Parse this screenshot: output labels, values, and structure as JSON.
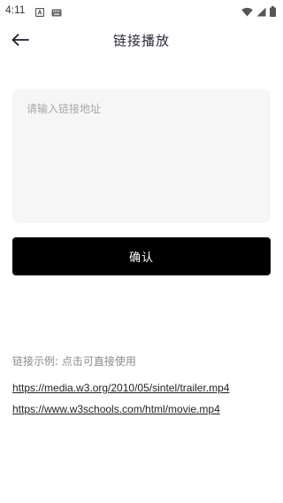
{
  "status_bar": {
    "time": "4:11",
    "icons": [
      "notification-a-icon",
      "keyboard-icon",
      "wifi-icon",
      "signal-icon",
      "battery-icon"
    ]
  },
  "header": {
    "title": "链接播放",
    "back_icon": "arrow-left-icon"
  },
  "input": {
    "placeholder": "请输入链接地址",
    "value": ""
  },
  "confirm_button": {
    "label": "确认"
  },
  "examples": {
    "label": "链接示例: 点击可直接使用",
    "links": [
      "https://media.w3.org/2010/05/sintel/trailer.mp4",
      "https://www.w3schools.com/html/movie.mp4"
    ]
  },
  "colors": {
    "button_bg": "#000000",
    "input_bg": "#f6f6f6",
    "hint_text": "#8c8c8c"
  }
}
